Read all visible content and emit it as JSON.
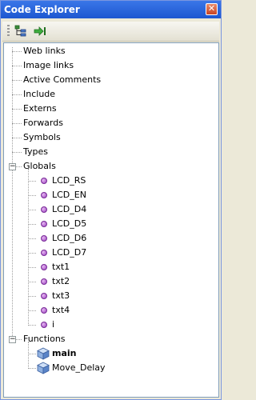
{
  "window": {
    "title": "Code Explorer",
    "close_glyph": "✕"
  },
  "toolbar": {
    "icons": [
      "tree-view-icon",
      "goto-icon"
    ]
  },
  "tree": {
    "top_items": [
      "Web links",
      "Image links",
      "Active Comments",
      "Include",
      "Externs",
      "Forwards",
      "Symbols",
      "Types"
    ],
    "globals": {
      "label": "Globals",
      "toggle": "−",
      "children": [
        "LCD_RS",
        "LCD_EN",
        "LCD_D4",
        "LCD_D5",
        "LCD_D6",
        "LCD_D7",
        "txt1",
        "txt2",
        "txt3",
        "txt4",
        "i"
      ]
    },
    "functions": {
      "label": "Functions",
      "toggle": "−",
      "children": [
        "main",
        "Move_Delay"
      ]
    }
  },
  "colors": {
    "titlebar": "#2a66dc",
    "bullet": "#9b3fbf",
    "cube": "#4a7ac8"
  }
}
